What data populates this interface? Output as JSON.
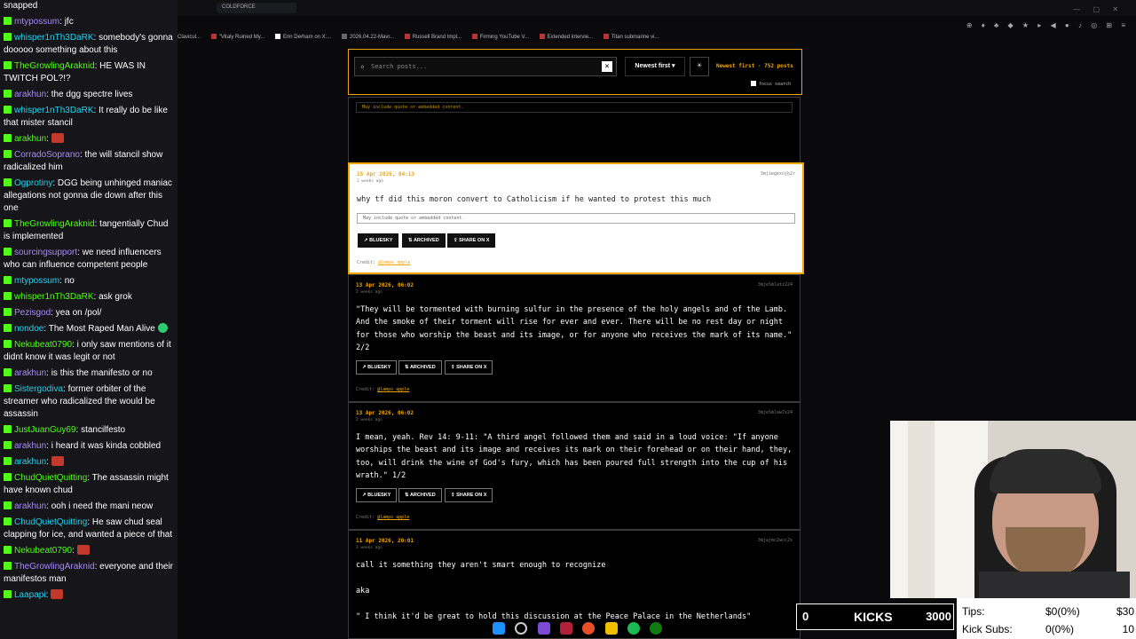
{
  "chat": {
    "messages": [
      {
        "user": "",
        "text": "snapped"
      },
      {
        "user": "mtypossum",
        "text": "jfc"
      },
      {
        "user": "whisper1nTh3DaRK",
        "text": "somebody's gonna dooooo something about this"
      },
      {
        "user": "TheGrowlingAraknid",
        "text": "HE WAS IN TWITCH POL?!?"
      },
      {
        "user": "arakhun",
        "text": "the dgg spectre lives"
      },
      {
        "user": "whisper1nTh3DaRK",
        "text": "It really do be like that mister stancil"
      },
      {
        "user": "arakhun",
        "text": "",
        "emote": true
      },
      {
        "user": "CorradoSoprano",
        "text": "the will stancil show radicalized him"
      },
      {
        "user": "Ogprotiny",
        "text": "DGG being unhinged maniac allegations not gonna die down after this one"
      },
      {
        "user": "TheGrowlingAraknid",
        "text": "tangentially Chud is implemented"
      },
      {
        "user": "sourcingsupport",
        "text": "we need influencers who can influence competent people"
      },
      {
        "user": "mtypossum",
        "text": "no"
      },
      {
        "user": "whisper1nTh3DaRK",
        "text": "ask grok"
      },
      {
        "user": "Pezisgod",
        "text": "yea on /pol/"
      },
      {
        "user": "nondoe",
        "text": "The Most Raped Man Alive",
        "emote_green": true
      },
      {
        "user": "Nekubeat0790",
        "text": "i only saw mentions of it didnt know it was legit or not"
      },
      {
        "user": "arakhun",
        "text": "is this the manifesto or no"
      },
      {
        "user": "Sistergodiva",
        "text": "former orbiter of the streamer who radicalized the would be assassin"
      },
      {
        "user": "JustJuanGuy69",
        "text": "stancilfesto"
      },
      {
        "user": "arakhun",
        "text": "i heard it was kinda cobbled"
      },
      {
        "user": "arakhun",
        "text": "",
        "emote": true
      },
      {
        "user": "ChudQuietQuitting",
        "text": "The assassin might have known chud"
      },
      {
        "user": "arakhun",
        "text": "ooh i need the mani neow"
      },
      {
        "user": "ChudQuietQuitting",
        "text": "He saw chud seal clapping for ice, and wanted a piece of that"
      },
      {
        "user": "Nekubeat0790",
        "text": "",
        "emote": true
      },
      {
        "user": "TheGrowlingAraknid",
        "text": "everyone and their manifestos man"
      },
      {
        "user": "Laapapi",
        "text": "",
        "emote": true
      }
    ],
    "user_colors": [
      "#53fc18",
      "#a78bfa",
      "#22d3ee"
    ]
  },
  "browser": {
    "tabs": [
      "COLDFORCE"
    ],
    "bookmarks": [
      "Clavicul...",
      "\"Vitaly Ruined My...",
      "Erin Derham on X:...",
      "2026.04.22-Mavr...",
      "Russell Brand Impl...",
      "Firming YouTube V...",
      "Extended intervie...",
      "Titan submarine vi..."
    ]
  },
  "page": {
    "search_placeholder": "Search posts...",
    "clear_label": "✕",
    "sort_label": "Newest first ▾",
    "theme_icon": "☀",
    "count_label": "Newest first · 752 posts",
    "focus_label": "focus search",
    "note_text": "May include quote or embedded content.",
    "btn_bluesky": "BLUESKY",
    "btn_archived": "ARCHIVED",
    "btn_share": "SHARE ON X",
    "credit_label": "Credit:",
    "credit_user": "@lamps_apple",
    "posts": [
      {
        "date": "15 Apr 2026, 04:13",
        "ago": "2 weeks ago",
        "id": "3mjiegexnjb2r",
        "body": "why tf did this moron convert to Catholicism if he wanted to protest this much"
      },
      {
        "date": "13 Apr 2026, 06:02",
        "ago": "2 weeks ago",
        "id": "3mjeSmlatz224",
        "body": "\"They will be tormented with burning sulfur in the presence of the holy angels and of the Lamb. And the smoke of their torment will rise for ever and ever. There will be no rest day or night for those who worship the beast and its image, or for anyone who receives the mark of its name.\" 2/2"
      },
      {
        "date": "13 Apr 2026, 06:02",
        "ago": "2 weeks ago",
        "id": "3mjeSmlaw7x24",
        "body": "I mean, yeah. Rev 14: 9-11: \"A third angel followed them and said in a loud voice: \"If anyone worships the beast and its image and receives its mark on their forehead or on their hand, they, too, will drink the wine of God's fury, which has been poured full strength into the cup of his wrath.\" 1/2"
      },
      {
        "date": "11 Apr 2026, 20:01",
        "ago": "3 weeks ago",
        "id": "3mjajmc2wcc2s",
        "body": "call it something they aren't smart enough to recognize\n\naka\n\n\" I think it'd be great to hold this discussion at the Peace Palace in the Netherlands\""
      }
    ]
  },
  "overlay": {
    "kicks_left": "0",
    "kicks_label": "KICKS",
    "kicks_right": "3000",
    "tips_label": "Tips:",
    "tips_value": "$0(0%)",
    "tips_extra": "$30",
    "subs_label": "Kick Subs:",
    "subs_value": "0(0%)",
    "subs_extra": "10"
  },
  "colors": {
    "accent": "#f0a500",
    "kick_green": "#53fc18"
  }
}
